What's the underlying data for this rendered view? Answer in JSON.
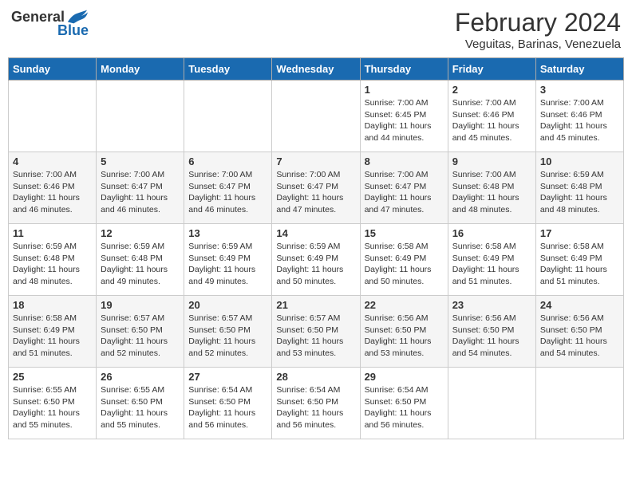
{
  "header": {
    "logo_general": "General",
    "logo_blue": "Blue",
    "month_year": "February 2024",
    "location": "Veguitas, Barinas, Venezuela"
  },
  "weekdays": [
    "Sunday",
    "Monday",
    "Tuesday",
    "Wednesday",
    "Thursday",
    "Friday",
    "Saturday"
  ],
  "weeks": [
    [
      {
        "day": "",
        "info": ""
      },
      {
        "day": "",
        "info": ""
      },
      {
        "day": "",
        "info": ""
      },
      {
        "day": "",
        "info": ""
      },
      {
        "day": "1",
        "info": "Sunrise: 7:00 AM\nSunset: 6:45 PM\nDaylight: 11 hours\nand 44 minutes."
      },
      {
        "day": "2",
        "info": "Sunrise: 7:00 AM\nSunset: 6:46 PM\nDaylight: 11 hours\nand 45 minutes."
      },
      {
        "day": "3",
        "info": "Sunrise: 7:00 AM\nSunset: 6:46 PM\nDaylight: 11 hours\nand 45 minutes."
      }
    ],
    [
      {
        "day": "4",
        "info": "Sunrise: 7:00 AM\nSunset: 6:46 PM\nDaylight: 11 hours\nand 46 minutes."
      },
      {
        "day": "5",
        "info": "Sunrise: 7:00 AM\nSunset: 6:47 PM\nDaylight: 11 hours\nand 46 minutes."
      },
      {
        "day": "6",
        "info": "Sunrise: 7:00 AM\nSunset: 6:47 PM\nDaylight: 11 hours\nand 46 minutes."
      },
      {
        "day": "7",
        "info": "Sunrise: 7:00 AM\nSunset: 6:47 PM\nDaylight: 11 hours\nand 47 minutes."
      },
      {
        "day": "8",
        "info": "Sunrise: 7:00 AM\nSunset: 6:47 PM\nDaylight: 11 hours\nand 47 minutes."
      },
      {
        "day": "9",
        "info": "Sunrise: 7:00 AM\nSunset: 6:48 PM\nDaylight: 11 hours\nand 48 minutes."
      },
      {
        "day": "10",
        "info": "Sunrise: 6:59 AM\nSunset: 6:48 PM\nDaylight: 11 hours\nand 48 minutes."
      }
    ],
    [
      {
        "day": "11",
        "info": "Sunrise: 6:59 AM\nSunset: 6:48 PM\nDaylight: 11 hours\nand 48 minutes."
      },
      {
        "day": "12",
        "info": "Sunrise: 6:59 AM\nSunset: 6:48 PM\nDaylight: 11 hours\nand 49 minutes."
      },
      {
        "day": "13",
        "info": "Sunrise: 6:59 AM\nSunset: 6:49 PM\nDaylight: 11 hours\nand 49 minutes."
      },
      {
        "day": "14",
        "info": "Sunrise: 6:59 AM\nSunset: 6:49 PM\nDaylight: 11 hours\nand 50 minutes."
      },
      {
        "day": "15",
        "info": "Sunrise: 6:58 AM\nSunset: 6:49 PM\nDaylight: 11 hours\nand 50 minutes."
      },
      {
        "day": "16",
        "info": "Sunrise: 6:58 AM\nSunset: 6:49 PM\nDaylight: 11 hours\nand 51 minutes."
      },
      {
        "day": "17",
        "info": "Sunrise: 6:58 AM\nSunset: 6:49 PM\nDaylight: 11 hours\nand 51 minutes."
      }
    ],
    [
      {
        "day": "18",
        "info": "Sunrise: 6:58 AM\nSunset: 6:49 PM\nDaylight: 11 hours\nand 51 minutes."
      },
      {
        "day": "19",
        "info": "Sunrise: 6:57 AM\nSunset: 6:50 PM\nDaylight: 11 hours\nand 52 minutes."
      },
      {
        "day": "20",
        "info": "Sunrise: 6:57 AM\nSunset: 6:50 PM\nDaylight: 11 hours\nand 52 minutes."
      },
      {
        "day": "21",
        "info": "Sunrise: 6:57 AM\nSunset: 6:50 PM\nDaylight: 11 hours\nand 53 minutes."
      },
      {
        "day": "22",
        "info": "Sunrise: 6:56 AM\nSunset: 6:50 PM\nDaylight: 11 hours\nand 53 minutes."
      },
      {
        "day": "23",
        "info": "Sunrise: 6:56 AM\nSunset: 6:50 PM\nDaylight: 11 hours\nand 54 minutes."
      },
      {
        "day": "24",
        "info": "Sunrise: 6:56 AM\nSunset: 6:50 PM\nDaylight: 11 hours\nand 54 minutes."
      }
    ],
    [
      {
        "day": "25",
        "info": "Sunrise: 6:55 AM\nSunset: 6:50 PM\nDaylight: 11 hours\nand 55 minutes."
      },
      {
        "day": "26",
        "info": "Sunrise: 6:55 AM\nSunset: 6:50 PM\nDaylight: 11 hours\nand 55 minutes."
      },
      {
        "day": "27",
        "info": "Sunrise: 6:54 AM\nSunset: 6:50 PM\nDaylight: 11 hours\nand 56 minutes."
      },
      {
        "day": "28",
        "info": "Sunrise: 6:54 AM\nSunset: 6:50 PM\nDaylight: 11 hours\nand 56 minutes."
      },
      {
        "day": "29",
        "info": "Sunrise: 6:54 AM\nSunset: 6:50 PM\nDaylight: 11 hours\nand 56 minutes."
      },
      {
        "day": "",
        "info": ""
      },
      {
        "day": "",
        "info": ""
      }
    ]
  ]
}
